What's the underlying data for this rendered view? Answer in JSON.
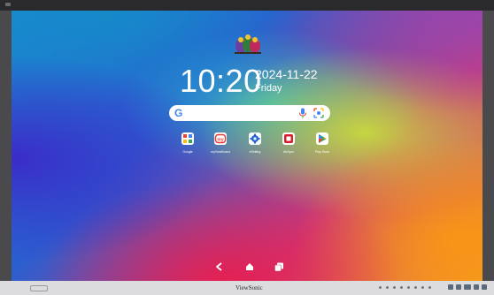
{
  "home": {
    "time": "10:20",
    "date": "2024-11-22",
    "day": "Friday"
  },
  "search": {
    "logo_letter": "G"
  },
  "apps": [
    {
      "label": "Google",
      "icon": "google-folder-icon"
    },
    {
      "label": "myViewBoard",
      "icon": "myviewboard-icon"
    },
    {
      "label": "vSetting",
      "icon": "vsetting-gear-icon"
    },
    {
      "label": "AirSync",
      "icon": "airsync-icon"
    },
    {
      "label": "Play Store",
      "icon": "play-store-icon"
    }
  ],
  "bezel": {
    "brand": "ViewSonic"
  },
  "colors": {
    "google_blue": "#4285f4",
    "google_red": "#ea4335",
    "google_yellow": "#fbbc05",
    "google_green": "#34a853",
    "myviewboard_red": "#e53935",
    "vsetting_blue": "#1e66d4",
    "airsync_red": "#d81e2c"
  }
}
